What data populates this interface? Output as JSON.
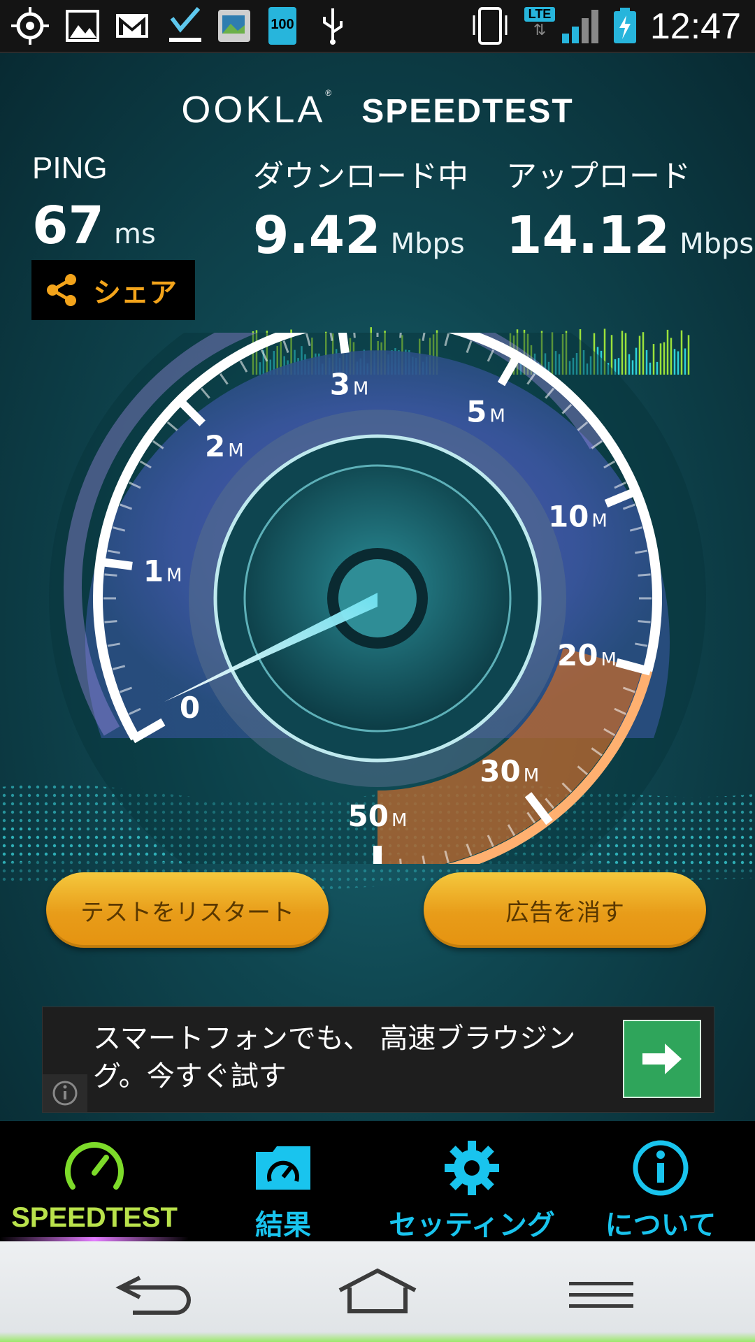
{
  "status_bar": {
    "time": "12:47",
    "battery_badge": "100",
    "network_type": "LTE",
    "icons": [
      "gps-icon",
      "gallery-icon",
      "gmail-icon",
      "download-done-icon",
      "photo-icon",
      "battery-100-icon",
      "usb-icon",
      "vibrate-icon",
      "lte-icon",
      "signal-icon",
      "battery-charging-icon"
    ]
  },
  "header": {
    "brand": "OOKLA",
    "product": "SPEEDTEST"
  },
  "stats": {
    "ping": {
      "label": "PING",
      "value": "67",
      "unit": "ms"
    },
    "download": {
      "label": "ダウンロード中",
      "value": "9.42",
      "unit": "Mbps"
    },
    "upload": {
      "label": "アップロード",
      "value": "14.12",
      "unit": "Mbps"
    }
  },
  "share": {
    "label": "シェア"
  },
  "gauge": {
    "ticks": [
      {
        "num": "0",
        "unit": ""
      },
      {
        "num": "1",
        "unit": "M"
      },
      {
        "num": "2",
        "unit": "M"
      },
      {
        "num": "3",
        "unit": "M"
      },
      {
        "num": "5",
        "unit": "M"
      },
      {
        "num": "10",
        "unit": "M"
      },
      {
        "num": "20",
        "unit": "M"
      },
      {
        "num": "30",
        "unit": "M"
      },
      {
        "num": "50",
        "unit": "M"
      }
    ],
    "needle_value_mbps": 0.3
  },
  "buttons": {
    "restart": "テストをリスタート",
    "remove_ads": "広告を消す"
  },
  "ad": {
    "text": "スマートフォンでも、 高速ブラウジング。今すぐ試す"
  },
  "tabs": [
    {
      "label": "SPEEDTEST",
      "icon": "speedometer-icon",
      "active": true
    },
    {
      "label": "結果",
      "icon": "results-folder-icon",
      "active": false
    },
    {
      "label": "セッティング",
      "icon": "gear-icon",
      "active": false
    },
    {
      "label": "について",
      "icon": "info-icon",
      "active": false
    }
  ],
  "colors": {
    "accent_orange": "#e89c19",
    "tab_active": "#7ddb2a",
    "tab_inactive": "#19c4ee",
    "gauge_purple": "#8d63d6",
    "gauge_orange": "#f08a2c"
  }
}
